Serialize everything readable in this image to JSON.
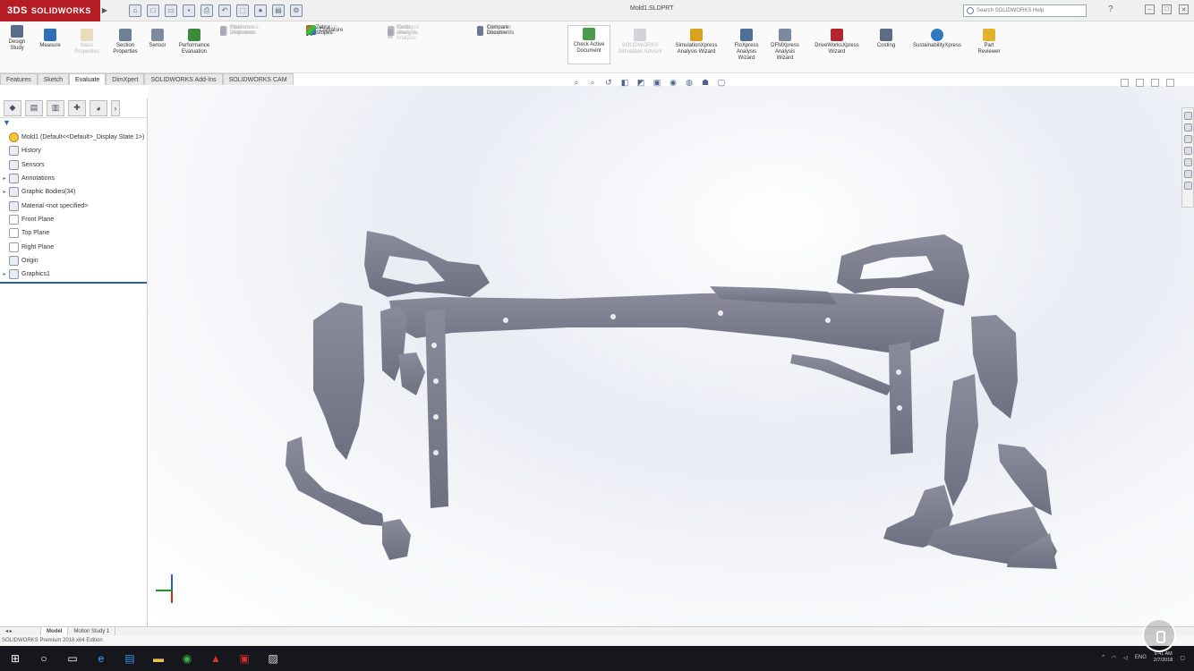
{
  "app": {
    "brand_ds": "3DS",
    "brand": "SOLIDWORKS",
    "doc_title": "Mold1.SLDPRT",
    "search_placeholder": "Search SOLIDWORKS Help"
  },
  "ribbon": {
    "large_commands": [
      {
        "label": "Design Study",
        "enabled": true
      },
      {
        "label": "Measure",
        "enabled": true
      },
      {
        "label": "Mass Properties",
        "enabled": false
      },
      {
        "label": "Section Properties",
        "enabled": true
      },
      {
        "label": "Sensor",
        "enabled": true
      },
      {
        "label": "Performance Evaluation",
        "enabled": true
      },
      {
        "label": "Check Active Document",
        "enabled": true
      },
      {
        "label": "SOLIDWORKS Simulation Advisor",
        "enabled": false
      },
      {
        "label": "SimulationXpress Analysis Wizard",
        "enabled": true
      },
      {
        "label": "FloXpress Analysis Wizard",
        "enabled": true
      },
      {
        "label": "DFMXpress Analysis Wizard",
        "enabled": true
      },
      {
        "label": "DriveWorksXpress Wizard",
        "enabled": true
      },
      {
        "label": "Costing",
        "enabled": true
      },
      {
        "label": "SustainabilityXpress",
        "enabled": true
      },
      {
        "label": "Part Reviewer",
        "enabled": true
      }
    ],
    "small_commands_col1": [
      {
        "label": "Interference Detection",
        "enabled": false
      },
      {
        "label": "Clearance Verification",
        "enabled": false
      },
      {
        "label": "Hole Alignment",
        "enabled": false
      }
    ],
    "small_commands_col2": [
      {
        "label": "Deviation Analysis",
        "enabled": false
      },
      {
        "label": "Zebra Stripes",
        "enabled": true
      },
      {
        "label": "Curvature",
        "enabled": true
      }
    ],
    "small_commands_col3": [
      {
        "label": "Draft Analysis",
        "enabled": false
      },
      {
        "label": "Undercut Analysis",
        "enabled": false
      },
      {
        "label": "Parting Line Analysis",
        "enabled": false
      }
    ],
    "small_commands_col4": [
      {
        "label": "Symmetry Check",
        "enabled": false
      },
      {
        "label": "Thickness Analysis",
        "enabled": false
      },
      {
        "label": "Compare Documents",
        "enabled": true
      }
    ]
  },
  "tabs": [
    "Features",
    "Sketch",
    "Evaluate",
    "DimXpert",
    "SOLIDWORKS Add-Ins",
    "SOLIDWORKS CAM"
  ],
  "active_tab": "Evaluate",
  "feature_tree": {
    "root": "Mold1 (Default<<Default>_Display State 1>)",
    "items": [
      {
        "label": "History",
        "expandable": false
      },
      {
        "label": "Sensors",
        "expandable": false
      },
      {
        "label": "Annotations",
        "expandable": true
      },
      {
        "label": "Graphic Bodies(34)",
        "expandable": true
      },
      {
        "label": "Material <not specified>",
        "expandable": false
      },
      {
        "label": "Front Plane",
        "expandable": false
      },
      {
        "label": "Top Plane",
        "expandable": false
      },
      {
        "label": "Right Plane",
        "expandable": false
      },
      {
        "label": "Origin",
        "expandable": false
      },
      {
        "label": "Graphics1",
        "expandable": true
      }
    ]
  },
  "bottom_tabs": [
    "Model",
    "Motion Study 1"
  ],
  "status_text": "SOLIDWORKS Premium 2018 x64 Edition",
  "taskbar": {
    "clock_time": "9:41 AM",
    "clock_date": "2/7/2018",
    "lang": "ENG"
  },
  "colors": {
    "brand": "#b51c24",
    "model": "#7a7d8c",
    "rollback": "#2b5fb1"
  }
}
